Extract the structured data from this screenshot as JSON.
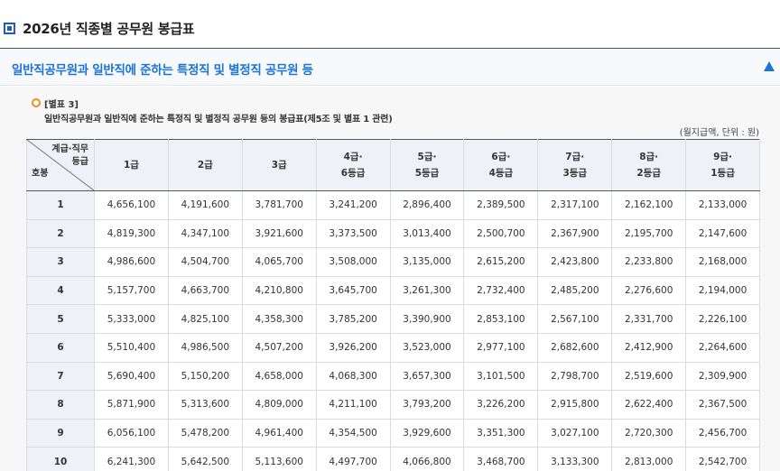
{
  "page": {
    "title": "2026년 직종별 공무원 봉급표"
  },
  "section": {
    "title": "일반직공무원과 일반직에 준하는 특정직 및 별정직 공무원 등"
  },
  "annex": {
    "label": "[별표 3]",
    "description": "일반직공무원과 일반직에 준하는 특정직 및 별정직 공무원 등의 봉급표(제5조 및 별표 1 관련)",
    "unit_note": "(월지급액, 단위 : 원)"
  },
  "table": {
    "corner": {
      "top_line1": "계급·직무",
      "top_line2": "등급",
      "bottom": "호봉"
    },
    "columns": [
      {
        "line1": "1급",
        "line2": ""
      },
      {
        "line1": "2급",
        "line2": ""
      },
      {
        "line1": "3급",
        "line2": ""
      },
      {
        "line1": "4급·",
        "line2": "6등급"
      },
      {
        "line1": "5급·",
        "line2": "5등급"
      },
      {
        "line1": "6급·",
        "line2": "4등급"
      },
      {
        "line1": "7급·",
        "line2": "3등급"
      },
      {
        "line1": "8급·",
        "line2": "2등급"
      },
      {
        "line1": "9급·",
        "line2": "1등급"
      }
    ],
    "rows": [
      {
        "step": "1",
        "values": [
          "4,656,100",
          "4,191,600",
          "3,781,700",
          "3,241,200",
          "2,896,400",
          "2,389,500",
          "2,317,100",
          "2,162,100",
          "2,133,000"
        ]
      },
      {
        "step": "2",
        "values": [
          "4,819,300",
          "4,347,100",
          "3,921,600",
          "3,373,500",
          "3,013,400",
          "2,500,700",
          "2,367,900",
          "2,195,700",
          "2,147,600"
        ]
      },
      {
        "step": "3",
        "values": [
          "4,986,600",
          "4,504,700",
          "4,065,700",
          "3,508,000",
          "3,135,000",
          "2,615,200",
          "2,423,800",
          "2,233,800",
          "2,168,000"
        ]
      },
      {
        "step": "4",
        "values": [
          "5,157,700",
          "4,663,700",
          "4,210,800",
          "3,645,700",
          "3,261,300",
          "2,732,400",
          "2,485,200",
          "2,276,600",
          "2,194,000"
        ]
      },
      {
        "step": "5",
        "values": [
          "5,333,000",
          "4,825,100",
          "4,358,300",
          "3,785,200",
          "3,390,900",
          "2,853,100",
          "2,567,100",
          "2,331,700",
          "2,226,100"
        ]
      },
      {
        "step": "6",
        "values": [
          "5,510,400",
          "4,986,500",
          "4,507,200",
          "3,926,200",
          "3,523,000",
          "2,977,100",
          "2,682,600",
          "2,412,900",
          "2,264,600"
        ]
      },
      {
        "step": "7",
        "values": [
          "5,690,400",
          "5,150,200",
          "4,658,000",
          "4,068,300",
          "3,657,300",
          "3,101,500",
          "2,798,700",
          "2,519,600",
          "2,309,900"
        ]
      },
      {
        "step": "8",
        "values": [
          "5,871,900",
          "5,313,600",
          "4,809,000",
          "4,211,100",
          "3,793,200",
          "3,226,200",
          "2,915,800",
          "2,622,400",
          "2,367,500"
        ]
      },
      {
        "step": "9",
        "values": [
          "6,056,100",
          "5,478,200",
          "4,961,400",
          "4,354,500",
          "3,929,600",
          "3,351,300",
          "3,027,100",
          "2,720,300",
          "2,456,700"
        ]
      },
      {
        "step": "10",
        "values": [
          "6,241,300",
          "5,642,500",
          "5,113,600",
          "4,497,700",
          "4,066,800",
          "3,468,700",
          "3,133,300",
          "2,813,000",
          "2,542,700"
        ]
      }
    ]
  },
  "colors": {
    "accent": "#1b74d8",
    "bullet_orange": "#f08a24",
    "header_bg": "#eef1f5"
  }
}
